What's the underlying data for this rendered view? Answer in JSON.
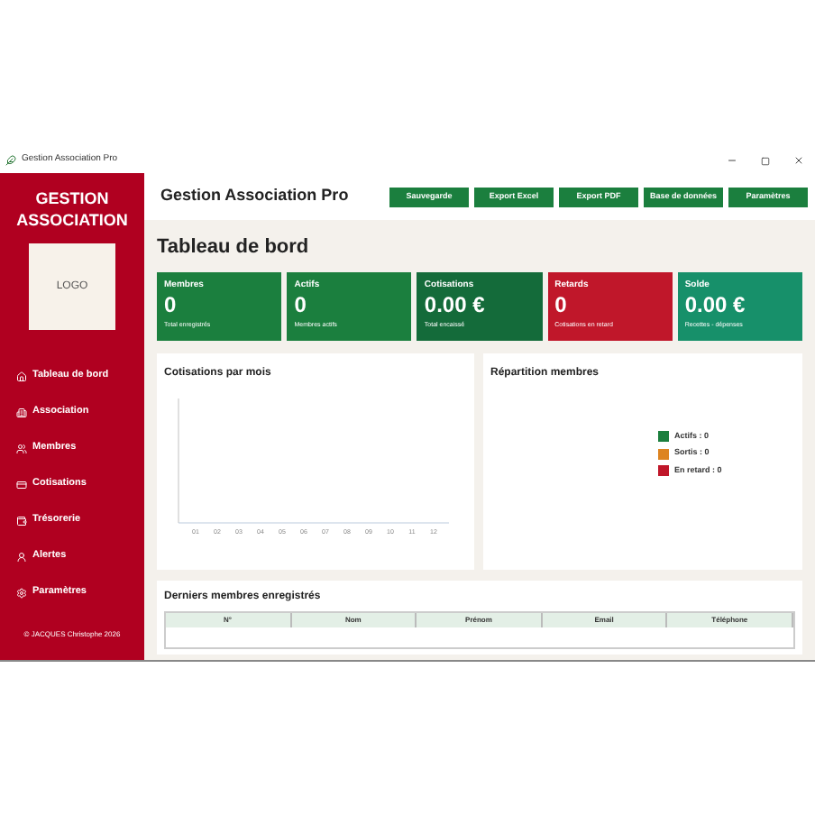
{
  "window": {
    "title": "Gestion Association Pro"
  },
  "sidebar": {
    "brand": "GESTION ASSOCIATION",
    "logo": "LOGO",
    "items": [
      {
        "label": "Tableau de bord",
        "kind": "home"
      },
      {
        "label": "Association",
        "kind": "building"
      },
      {
        "label": "Membres",
        "kind": "users"
      },
      {
        "label": "Cotisations",
        "kind": "card"
      },
      {
        "label": "Trésorerie",
        "kind": "wallet"
      },
      {
        "label": "Alertes",
        "kind": "person"
      },
      {
        "label": "Paramètres",
        "kind": "gear"
      }
    ],
    "footer": "© JACQUES Christophe 2026"
  },
  "header": {
    "title": "Gestion Association Pro",
    "buttons": [
      "Sauvegarde",
      "Export Excel",
      "Export PDF",
      "Base de données",
      "Paramètres"
    ]
  },
  "page_title": "Tableau de bord",
  "stats": [
    {
      "label": "Membres",
      "value": "0",
      "caption": "Total enregistrés",
      "color": "#1b7f3e"
    },
    {
      "label": "Actifs",
      "value": "0",
      "caption": "Membres actifs",
      "color": "#1b7f3e"
    },
    {
      "label": "Cotisations",
      "value": "0.00 €",
      "caption": "Total encaissé",
      "color": "#146b3a"
    },
    {
      "label": "Retards",
      "value": "0",
      "caption": "Cotisations en retard",
      "color": "#c0172a"
    },
    {
      "label": "Solde",
      "value": "0.00 €",
      "caption": "Recettes - dépenses",
      "color": "#17906a"
    }
  ],
  "monthly_panel": {
    "title": "Cotisations par mois",
    "month_labels": [
      "01",
      "02",
      "03",
      "04",
      "05",
      "06",
      "07",
      "08",
      "09",
      "10",
      "11",
      "12"
    ]
  },
  "distribution_panel": {
    "title": "Répartition membres",
    "legend": [
      {
        "label": "Actifs : 0",
        "color": "#1b7f3e"
      },
      {
        "label": "Sortis : 0",
        "color": "#dd8421"
      },
      {
        "label": "En retard : 0",
        "color": "#c0172a"
      }
    ]
  },
  "members_table": {
    "title": "Derniers membres enregistrés",
    "columns": [
      "N°",
      "Nom",
      "Prénom",
      "Email",
      "Téléphone"
    ]
  }
}
